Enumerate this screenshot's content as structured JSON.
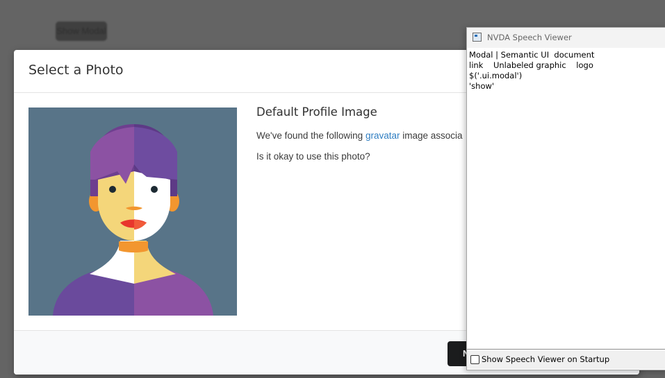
{
  "background": {
    "button_label": "Show Modal"
  },
  "modal": {
    "title": "Select a Photo",
    "image_alt": "avatar illustration",
    "content": {
      "header": "Default Profile Image",
      "line1_prefix": "We've found the following ",
      "line1_link": "gravatar",
      "line1_suffix": " image associa",
      "line2": "Is it okay to use this photo?"
    },
    "actions": {
      "deny_label": "N"
    }
  },
  "speech_viewer": {
    "title": "NVDA Speech Viewer",
    "log_lines": [
      "Modal | Semantic UI  document",
      "link    Unlabeled graphic    logo",
      "$('.ui.modal')",
      "'show'"
    ],
    "startup_checkbox_label": "Show Speech Viewer on Startup",
    "startup_checked": false
  },
  "colors": {
    "avatar_bg": "#587488",
    "hair_purple": "#6e3f8f",
    "link_blue": "#2f7ec2"
  }
}
